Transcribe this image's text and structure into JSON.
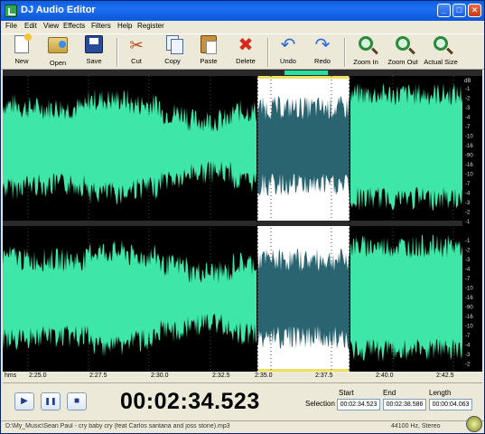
{
  "window": {
    "title": "DJ Audio Editor",
    "minimize_glyph": "_",
    "maximize_glyph": "□",
    "close_glyph": "✕"
  },
  "menu": [
    "File",
    "Edit",
    "View",
    "Effects",
    "Filters",
    "Help",
    "Register"
  ],
  "toolbar": {
    "new": "New",
    "open": "Open",
    "save": "Save",
    "cut": "Cut",
    "copy": "Copy",
    "paste": "Paste",
    "delete": "Delete",
    "undo": "Undo",
    "redo": "Redo",
    "zoom_in": "Zoom In",
    "zoom_out": "Zoom Out",
    "actual_size": "Actual Size"
  },
  "icons": {
    "cut": "✂",
    "delete": "✖",
    "undo": "↶",
    "redo": "↷",
    "play": "▶",
    "pause": "❚❚",
    "stop": "■"
  },
  "db_scale": {
    "unit": "dB",
    "channel1": [
      "-1",
      "-2",
      "-3",
      "-4",
      "-7",
      "-10",
      "-16",
      "-90",
      "-16",
      "-10",
      "-7",
      "-4",
      "-3",
      "-2",
      "-1"
    ],
    "channel2": [
      "-1",
      "-2",
      "-3",
      "-4",
      "-7",
      "-10",
      "-16",
      "-90",
      "-16",
      "-10",
      "-7",
      "-4",
      "-3",
      "-2",
      "-1"
    ]
  },
  "ruler": {
    "unit_label": "hms",
    "ticks": [
      "2:25.0",
      "2:27.5",
      "2:30.0",
      "2:32.5",
      "2:35.0",
      "2:37.5",
      "2:40.0",
      "2:42.5"
    ]
  },
  "transport": {
    "time": "00:02:34.523"
  },
  "selection": {
    "label": "Selection",
    "start_label": "Start",
    "end_label": "End",
    "length_label": "Length",
    "start": "00:02:34.523",
    "end": "00:02:38.586",
    "length": "00:00:04.063"
  },
  "status": {
    "path": "D:\\My_Music\\Sean Paul - cry baby cry (feat Carlos santana and joss stone).mp3",
    "format": "44100 Hz, Stereo"
  },
  "colors": {
    "wave": "#3ee6a8",
    "wave_selected": "#2a6470",
    "selection_bg": "#ffffff",
    "background": "#000000"
  }
}
